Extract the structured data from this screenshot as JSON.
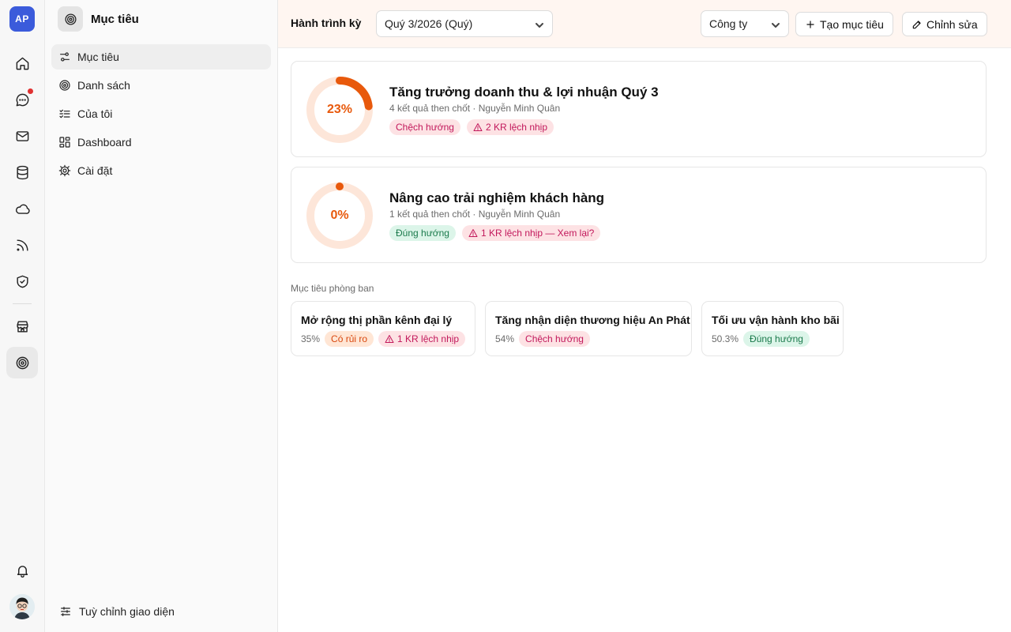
{
  "rail": {
    "logo_text": "AP",
    "items": [
      "home-icon",
      "chat-icon",
      "mail-icon",
      "database-icon",
      "cloud-icon",
      "feed-icon",
      "shield-icon",
      "store-icon",
      "target-icon"
    ],
    "notification_color": "#e03131"
  },
  "sidebar": {
    "title": "Mục tiêu",
    "items": [
      {
        "label": "Mục tiêu",
        "icon": "sliders-icon",
        "active": true
      },
      {
        "label": "Danh sách",
        "icon": "target-icon"
      },
      {
        "label": "Của tôi",
        "icon": "checklist-icon"
      },
      {
        "label": "Dashboard",
        "icon": "grid-icon"
      },
      {
        "label": "Cài đặt",
        "icon": "gear-icon"
      }
    ],
    "footer_label": "Tuỳ chỉnh giao diện"
  },
  "topbar": {
    "period_label": "Hành trình kỳ",
    "period_value": "Quý 3/2026 (Quý)",
    "scope_value": "Công ty",
    "create_button": "Tạo mục tiêu",
    "edit_button": "Chỉnh sửa"
  },
  "objectives": [
    {
      "progress": 23,
      "progress_label": "23%",
      "title": "Tăng trưởng doanh thu & lợi nhuận Quý 3",
      "meta": "4 kết quả then chốt · Nguyễn Minh Quân",
      "status": "Chệch hướng",
      "alert": "2 KR lệch nhịp"
    },
    {
      "progress": 0,
      "progress_label": "0%",
      "title": "Nâng cao trải nghiệm khách hàng",
      "meta": "1 kết quả then chốt · Nguyễn Minh Quân",
      "status": "Đúng hướng",
      "alert": "1 KR lệch nhịp — Xem lại?"
    }
  ],
  "department": {
    "label": "Mục tiêu phòng ban",
    "cards": [
      {
        "title": "Mở rộng thị phần kênh đại lý",
        "pct": "35%",
        "status": "Có rủi ro",
        "alert": "1 KR lệch nhịp"
      },
      {
        "title": "Tăng nhận diện thương hiệu An Phát",
        "pct": "54%",
        "status": "Chệch hướng"
      },
      {
        "title": "Tối ưu vận hành kho bãi",
        "pct": "50.3%",
        "status": "Đúng hướng"
      }
    ]
  },
  "colors": {
    "accent": "#e8590c",
    "ring_track": "#fde6d9",
    "off_track": "#c2185b",
    "on_track": "#1b7a4c",
    "at_risk": "#d9480f"
  }
}
